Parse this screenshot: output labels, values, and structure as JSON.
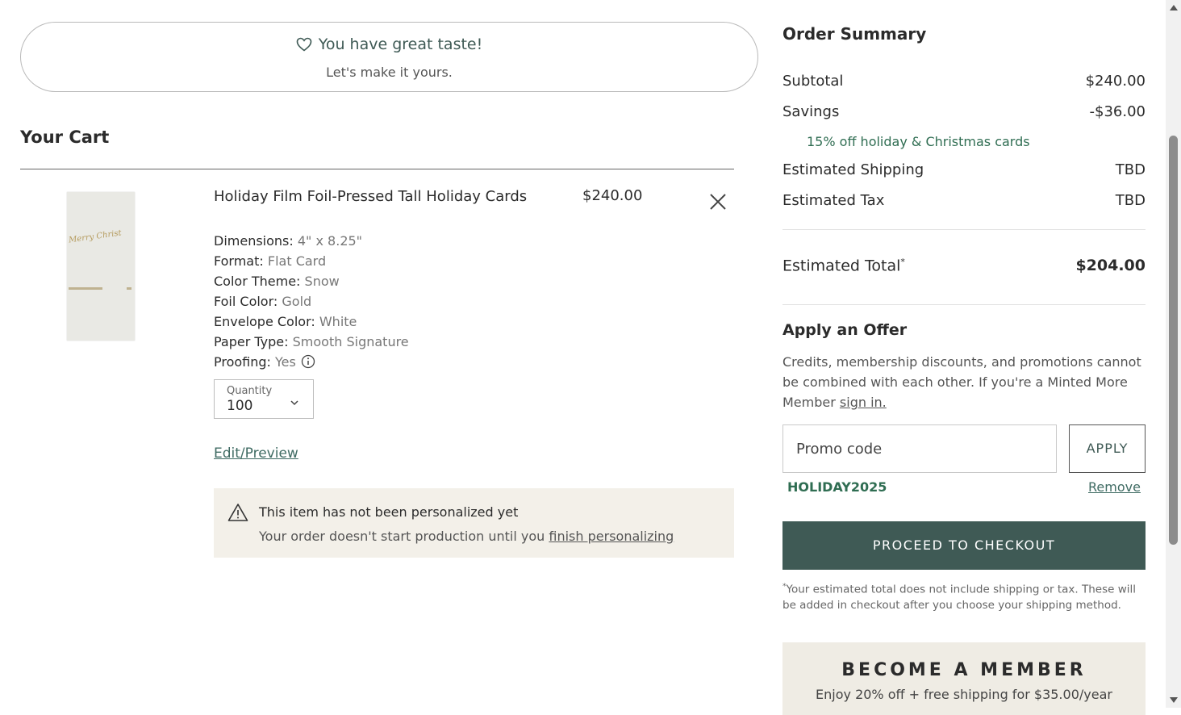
{
  "banner": {
    "line1": "You have great taste!",
    "line2": "Let's make it yours.",
    "icon": "heart-icon"
  },
  "cart": {
    "title": "Your Cart",
    "item": {
      "name": "Holiday Film Foil-Pressed Tall Holiday Cards",
      "price": "$240.00",
      "thumbnail_text": "Merry Christ",
      "attributes": [
        {
          "label": "Dimensions:",
          "value": "4\" x 8.25\""
        },
        {
          "label": "Format:",
          "value": "Flat Card"
        },
        {
          "label": "Color Theme:",
          "value": "Snow"
        },
        {
          "label": "Foil Color:",
          "value": "Gold"
        },
        {
          "label": "Envelope Color:",
          "value": "White"
        },
        {
          "label": "Paper Type:",
          "value": "Smooth Signature"
        },
        {
          "label": "Proofing:",
          "value": "Yes"
        }
      ],
      "quantity_label": "Quantity",
      "quantity_value": "100",
      "edit_link": "Edit/Preview"
    },
    "alert": {
      "title": "This item has not been personalized yet",
      "body": "Your order doesn't start production until you ",
      "link": "finish personalizing"
    }
  },
  "summary": {
    "title": "Order Summary",
    "subtotal_label": "Subtotal",
    "subtotal_value": "$240.00",
    "savings_label": "Savings",
    "savings_value": "-$36.00",
    "promo_note": "15% off holiday & Christmas cards",
    "shipping_label": "Estimated Shipping",
    "shipping_value": "TBD",
    "tax_label": "Estimated Tax",
    "tax_value": "TBD",
    "total_label": "Estimated Total",
    "total_mark": "*",
    "total_value": "$204.00"
  },
  "offer": {
    "title": "Apply an Offer",
    "text": "Credits, membership discounts, and promotions cannot be combined with each other. If you're a Minted More Member ",
    "link": "sign in.",
    "promo_placeholder": "Promo code",
    "apply_label": "APPLY",
    "applied_code": "HOLIDAY2025",
    "remove_label": "Remove"
  },
  "checkout": {
    "button_label": "PROCEED TO CHECKOUT",
    "disclaimer_mark": "*",
    "disclaimer": "Your estimated total does not include shipping or tax. These will be added in checkout after you choose your shipping method."
  },
  "member": {
    "title": "BECOME A MEMBER",
    "subtitle": "Enjoy 20% off + free shipping for $35.00/year"
  },
  "colors": {
    "accent": "#3f5a55",
    "promo_green": "#2f6d52",
    "alert_bg": "#f3f0e9",
    "member_bg": "#efece4"
  }
}
